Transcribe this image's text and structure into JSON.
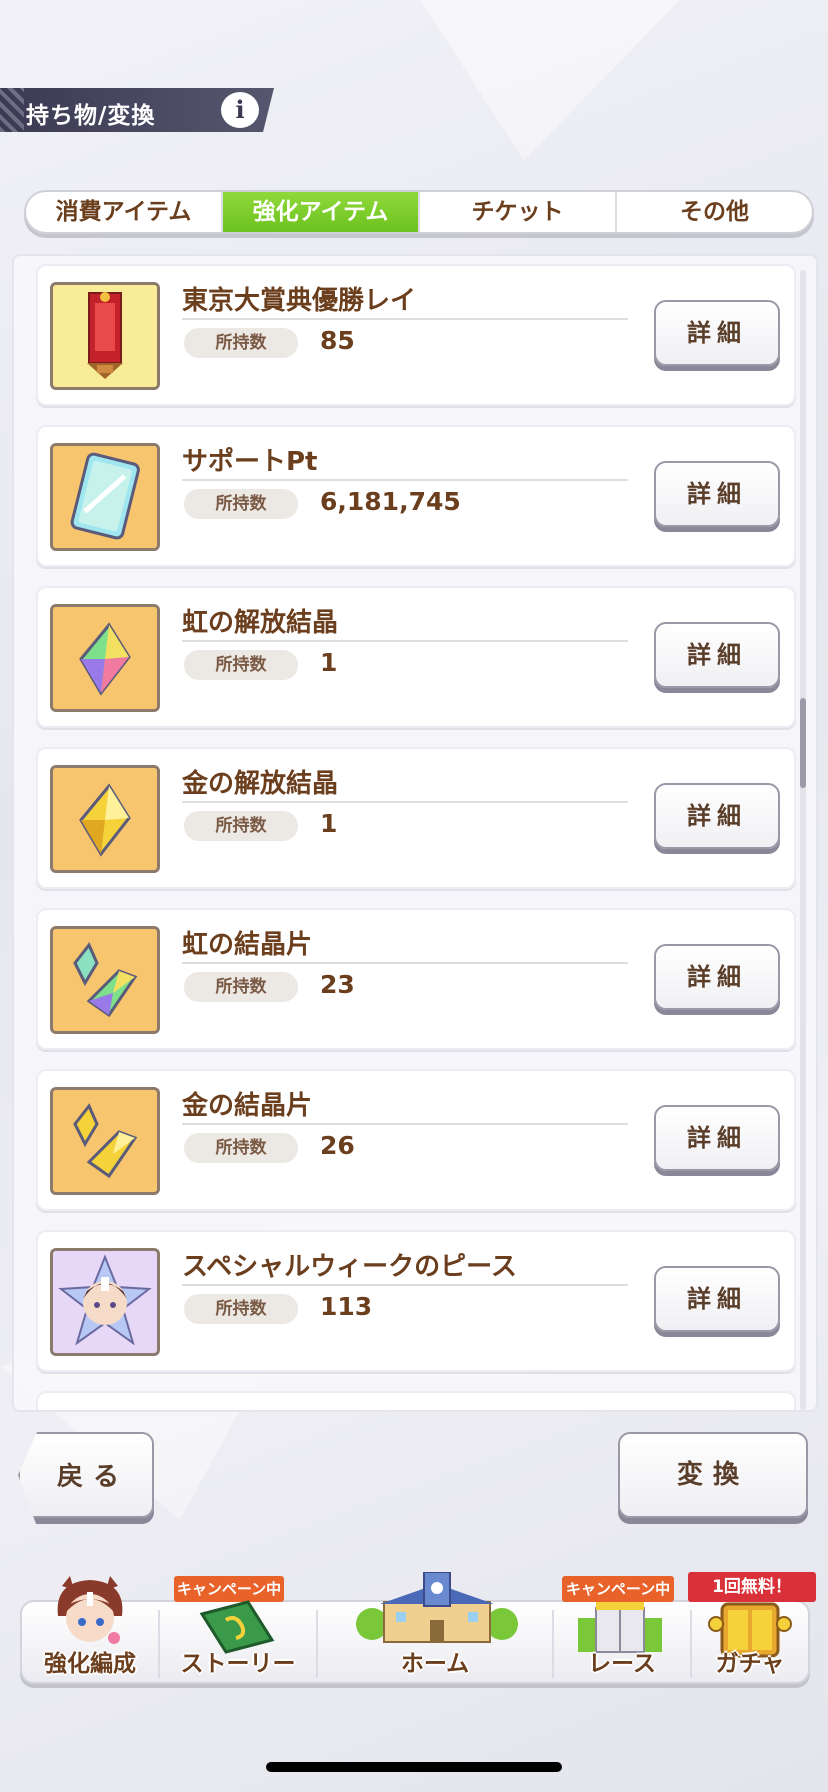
{
  "header": {
    "title": "持ち物/変換",
    "info_icon": "i"
  },
  "tabs": [
    {
      "label": "消費アイテム",
      "active": false
    },
    {
      "label": "強化アイテム",
      "active": true
    },
    {
      "label": "チケット",
      "active": false
    },
    {
      "label": "その他",
      "active": false
    }
  ],
  "items": [
    {
      "name": "東京大賞典優勝レイ",
      "count_label": "所持数",
      "count": "85",
      "detail": "詳細",
      "icon": "tokyo-daishoten-lei-icon"
    },
    {
      "name": "サポートPt",
      "count_label": "所持数",
      "count": "6,181,745",
      "detail": "詳細",
      "icon": "support-pt-card-icon"
    },
    {
      "name": "虹の解放結晶",
      "count_label": "所持数",
      "count": "1",
      "detail": "詳細",
      "icon": "rainbow-crystal-icon"
    },
    {
      "name": "金の解放結晶",
      "count_label": "所持数",
      "count": "1",
      "detail": "詳細",
      "icon": "gold-crystal-icon"
    },
    {
      "name": "虹の結晶片",
      "count_label": "所持数",
      "count": "23",
      "detail": "詳細",
      "icon": "rainbow-shard-icon"
    },
    {
      "name": "金の結晶片",
      "count_label": "所持数",
      "count": "26",
      "detail": "詳細",
      "icon": "gold-shard-icon"
    },
    {
      "name": "スペシャルウィークのピース",
      "count_label": "所持数",
      "count": "113",
      "detail": "詳細",
      "icon": "special-week-piece-icon"
    }
  ],
  "buttons": {
    "back": "戻る",
    "convert": "変換"
  },
  "nav": [
    {
      "label": "強化編成",
      "badge": "",
      "icon": "character-icon"
    },
    {
      "label": "ストーリー",
      "badge": "キャンペーン中",
      "icon": "storybook-icon"
    },
    {
      "label": "ホーム",
      "badge": "",
      "icon": "school-building-icon"
    },
    {
      "label": "レース",
      "badge": "キャンペーン中",
      "icon": "race-gate-icon"
    },
    {
      "label": "ガチャ",
      "badge": "1回無料！",
      "icon": "gacha-gate-icon"
    }
  ],
  "colors": {
    "active_tab": "#7ccc2a",
    "text_brown": "#6b3e1d",
    "badge_orange": "#e8622a",
    "badge_red": "#d9303a"
  }
}
